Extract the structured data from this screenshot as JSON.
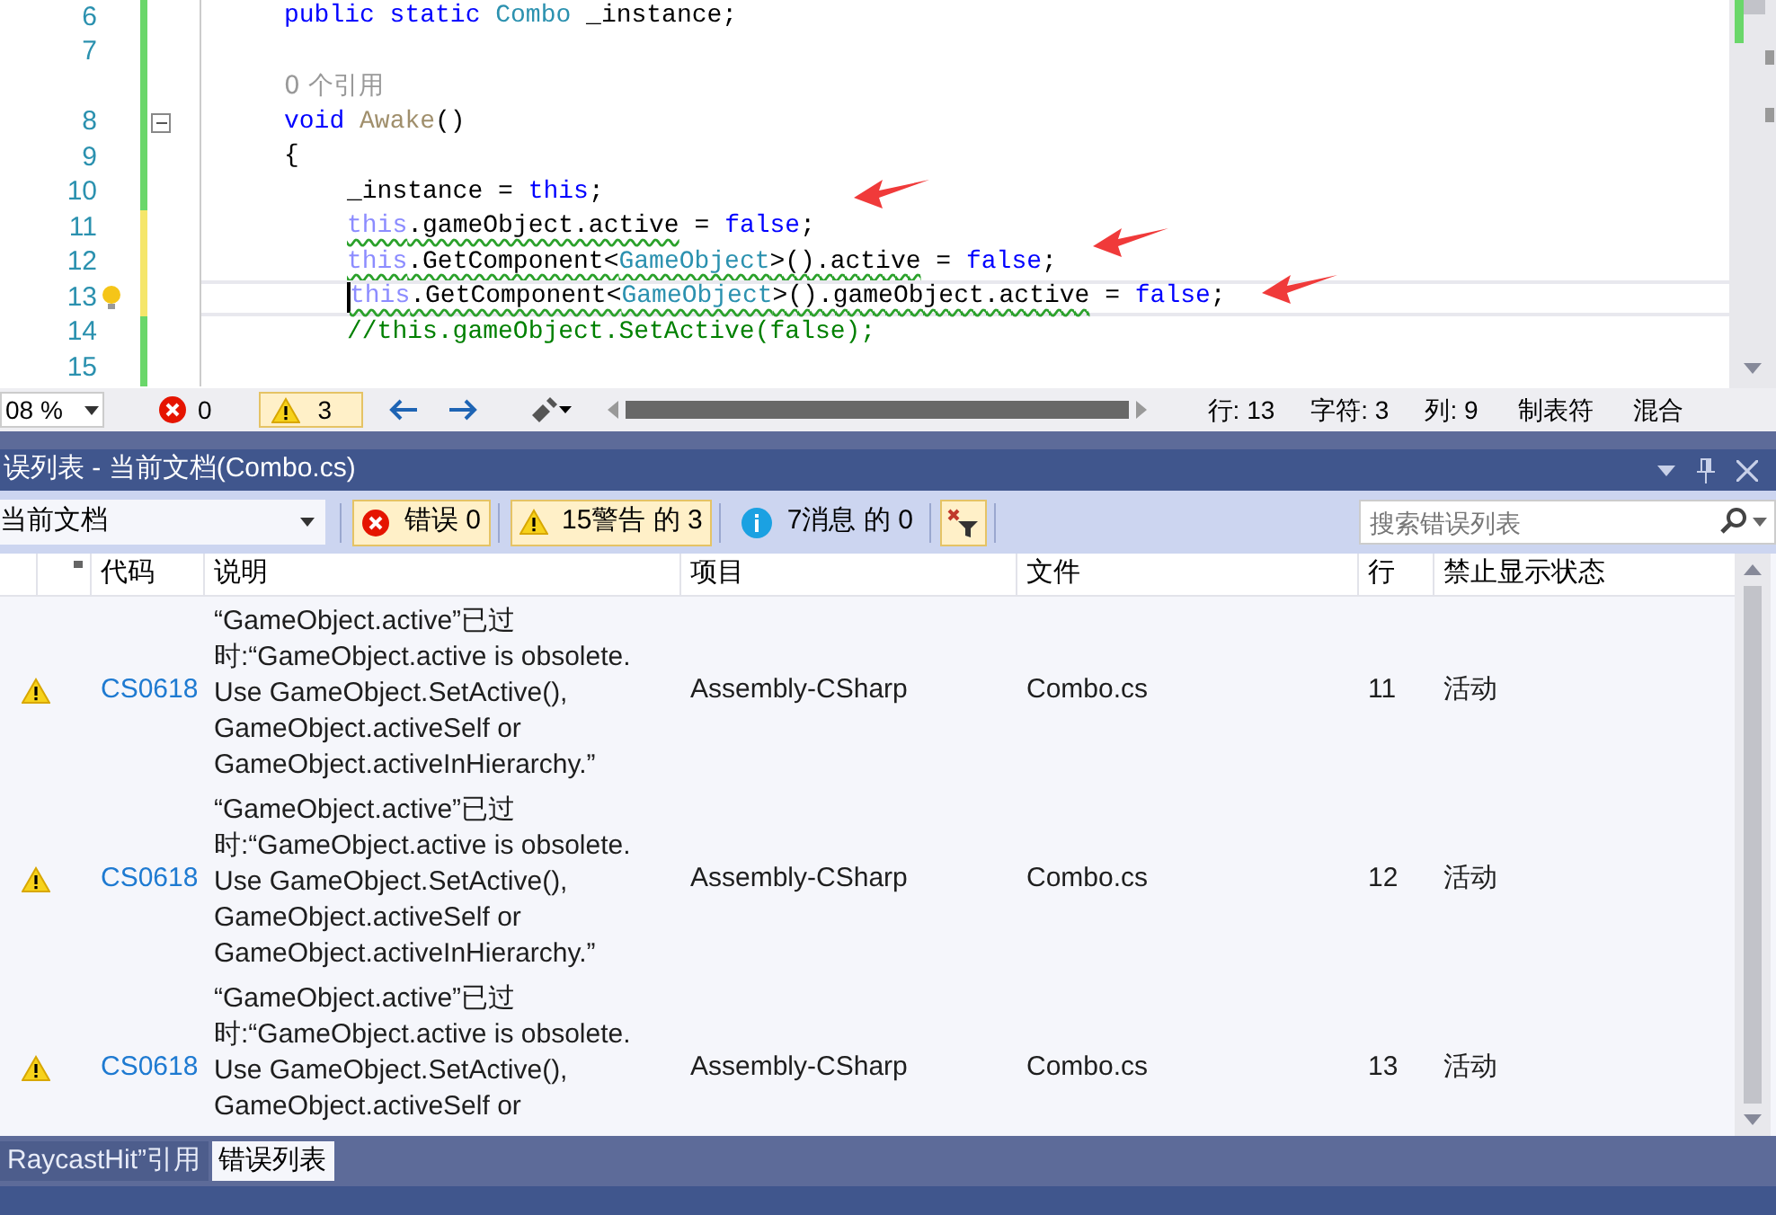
{
  "editor": {
    "lines": [
      {
        "kind": "code",
        "number": "6",
        "unsaved": false,
        "tokens": [
          {
            "kind": "keyword",
            "text": "public static "
          },
          {
            "kind": "type",
            "text": "Combo"
          },
          {
            "kind": "plain",
            "text": " _instance;"
          }
        ]
      },
      {
        "kind": "code",
        "number": "7",
        "unsaved": false
      },
      {
        "kind": "codelens",
        "text": "0 个引用"
      },
      {
        "kind": "code",
        "number": "8",
        "unsaved": false,
        "fold": true,
        "tokens": [
          {
            "kind": "keyword",
            "text": "void "
          },
          {
            "kind": "unused",
            "text": "Awake"
          },
          {
            "kind": "plain",
            "text": "()"
          }
        ]
      },
      {
        "kind": "code",
        "number": "9",
        "unsaved": false,
        "tokens": [
          {
            "kind": "plain",
            "text": "{"
          }
        ],
        "children": [
          {
            "kind": "code",
            "number": "10",
            "unsaved": false,
            "tokens": [
              {
                "kind": "plain",
                "text": "_instance = "
              },
              {
                "kind": "keyword",
                "text": "this"
              },
              {
                "kind": "plain",
                "text": ";"
              }
            ]
          },
          {
            "kind": "code",
            "number": "11",
            "unsaved": true,
            "tokens": [
              {
                "kind": "faded",
                "text": "this",
                "squiggle": true
              },
              {
                "kind": "plain",
                "text": ".gameObject.active",
                "squiggle": true
              },
              {
                "kind": "plain",
                "text": " = "
              },
              {
                "kind": "keyword",
                "text": "false"
              },
              {
                "kind": "plain",
                "text": ";"
              }
            ]
          },
          {
            "kind": "code",
            "number": "12",
            "unsaved": true,
            "tokens": [
              {
                "kind": "faded",
                "text": "this",
                "squiggle": true
              },
              {
                "kind": "plain",
                "text": ".GetComponent<",
                "squiggle": true
              },
              {
                "kind": "type",
                "text": "GameObject",
                "squiggle": true
              },
              {
                "kind": "plain",
                "text": ">().active",
                "squiggle": true
              },
              {
                "kind": "plain",
                "text": " = "
              },
              {
                "kind": "keyword",
                "text": "false"
              },
              {
                "kind": "plain",
                "text": ";"
              }
            ]
          },
          {
            "kind": "code",
            "number": "13",
            "unsaved": true,
            "current": true,
            "lightbulb": true,
            "tokens": [
              {
                "kind": "faded",
                "text": "this",
                "squiggle": true
              },
              {
                "kind": "plain",
                "text": ".GetComponent<",
                "squiggle": true
              },
              {
                "kind": "type",
                "text": "GameObject",
                "squiggle": true
              },
              {
                "kind": "plain",
                "text": ">().gameObject.active",
                "squiggle": true
              },
              {
                "kind": "plain",
                "text": " = "
              },
              {
                "kind": "keyword",
                "text": "false"
              },
              {
                "kind": "plain",
                "text": ";"
              }
            ]
          },
          {
            "kind": "code",
            "number": "14",
            "unsaved": false,
            "tokens": [
              {
                "kind": "comment",
                "text": "//this.gameObject.SetActive(false);"
              }
            ]
          }
        ]
      },
      {
        "kind": "code",
        "number": "15",
        "unsaved": false
      }
    ],
    "status": {
      "zoom": "08 %",
      "errors": "0",
      "warnings": "3",
      "warnings_selected": true,
      "line": "行: 13",
      "char": "字符: 3",
      "col": "列: 9",
      "tabs": "制表符",
      "line_endings": "混合"
    }
  },
  "error_list": {
    "title": "误列表 - 当前文档(Combo.cs)",
    "scope": "当前文档",
    "filters": [
      {
        "kind": "error",
        "label": "错误 0",
        "selected": true
      },
      {
        "kind": "warning",
        "label": "15警告 的 3",
        "selected": true
      },
      {
        "kind": "info",
        "label": "7消息 的 0",
        "selected": false
      }
    ],
    "filter_toggle_selected": true,
    "search": {
      "placeholder": "搜索错误列表"
    },
    "columns": [
      "代码",
      "说明",
      "项目",
      "文件",
      "行",
      "禁止显示状态"
    ],
    "rows": [
      {
        "kind": "warning",
        "code": "CS0618",
        "description_lines": [
          "“GameObject.active”已过",
          "时:“GameObject.active is obsolete.",
          "Use GameObject.SetActive(),",
          "GameObject.activeSelf or",
          "GameObject.activeInHierarchy.”"
        ],
        "project": "Assembly-CSharp",
        "file": "Combo.cs",
        "line": "11",
        "state": "活动"
      },
      {
        "kind": "warning",
        "code": "CS0618",
        "description_lines": [
          "“GameObject.active”已过",
          "时:“GameObject.active is obsolete.",
          "Use GameObject.SetActive(),",
          "GameObject.activeSelf or",
          "GameObject.activeInHierarchy.”"
        ],
        "project": "Assembly-CSharp",
        "file": "Combo.cs",
        "line": "12",
        "state": "活动"
      },
      {
        "kind": "warning",
        "code": "CS0618",
        "description_lines": [
          "“GameObject.active”已过",
          "时:“GameObject.active is obsolete.",
          "Use GameObject.SetActive(),",
          "GameObject.activeSelf or"
        ],
        "project": "Assembly-CSharp",
        "file": "Combo.cs",
        "line": "13",
        "state": "活动"
      }
    ]
  },
  "bottom_tabs": [
    {
      "label": "RaycastHit”引用",
      "selected": false
    },
    {
      "label": "错误列表",
      "selected": true
    }
  ]
}
